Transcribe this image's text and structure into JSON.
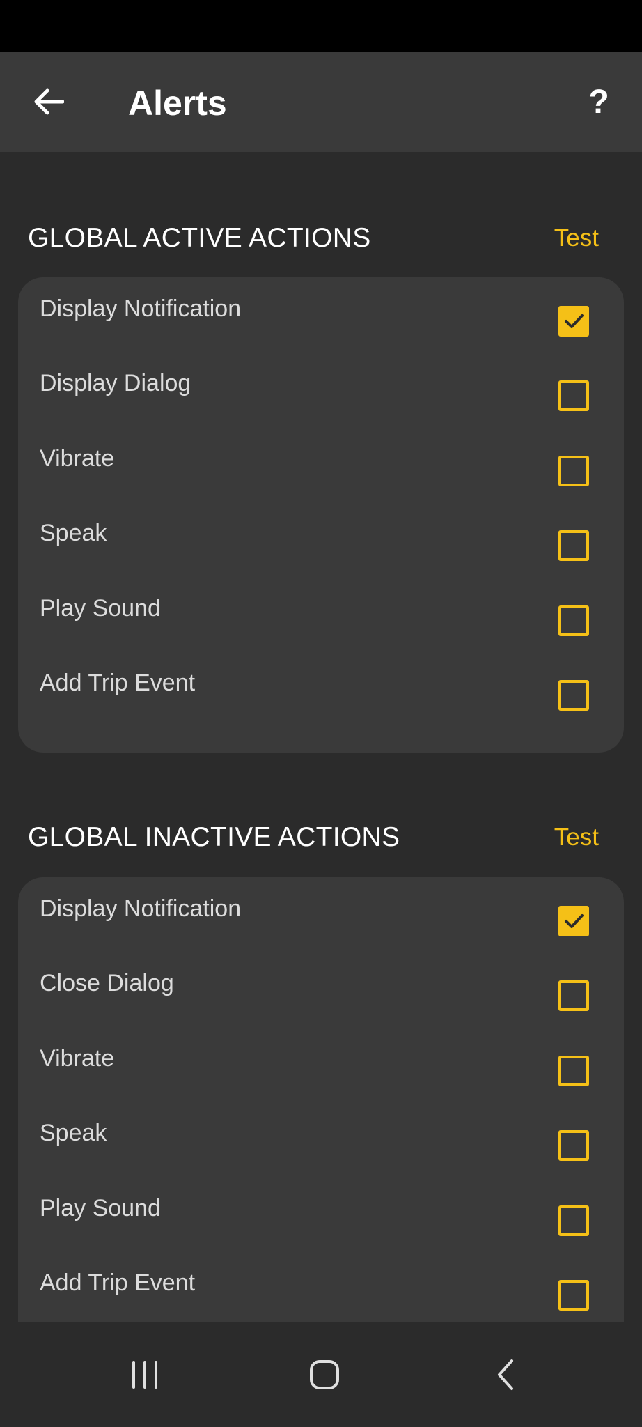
{
  "header": {
    "title": "Alerts",
    "back_icon": "arrow-left-icon",
    "help_label": "?"
  },
  "colors": {
    "accent": "#f5c017",
    "background": "#2b2b2b",
    "card": "#3a3a3a",
    "app_bar": "#3a3a3a",
    "status_bar": "#000000"
  },
  "sections": [
    {
      "title": "GLOBAL ACTIVE ACTIONS",
      "test_label": "Test",
      "items": [
        {
          "label": "Display Notification",
          "checked": true
        },
        {
          "label": "Display Dialog",
          "checked": false
        },
        {
          "label": "Vibrate",
          "checked": false
        },
        {
          "label": "Speak",
          "checked": false
        },
        {
          "label": "Play Sound",
          "checked": false
        },
        {
          "label": "Add Trip Event",
          "checked": false
        }
      ]
    },
    {
      "title": "GLOBAL INACTIVE ACTIONS",
      "test_label": "Test",
      "items": [
        {
          "label": "Display Notification",
          "checked": true
        },
        {
          "label": "Close Dialog",
          "checked": false
        },
        {
          "label": "Vibrate",
          "checked": false
        },
        {
          "label": "Speak",
          "checked": false
        },
        {
          "label": "Play Sound",
          "checked": false
        },
        {
          "label": "Add Trip Event",
          "checked": false
        }
      ]
    }
  ],
  "nav": {
    "recents_icon": "recent-apps-icon",
    "home_icon": "home-icon",
    "back_icon": "back-chevron-icon"
  }
}
